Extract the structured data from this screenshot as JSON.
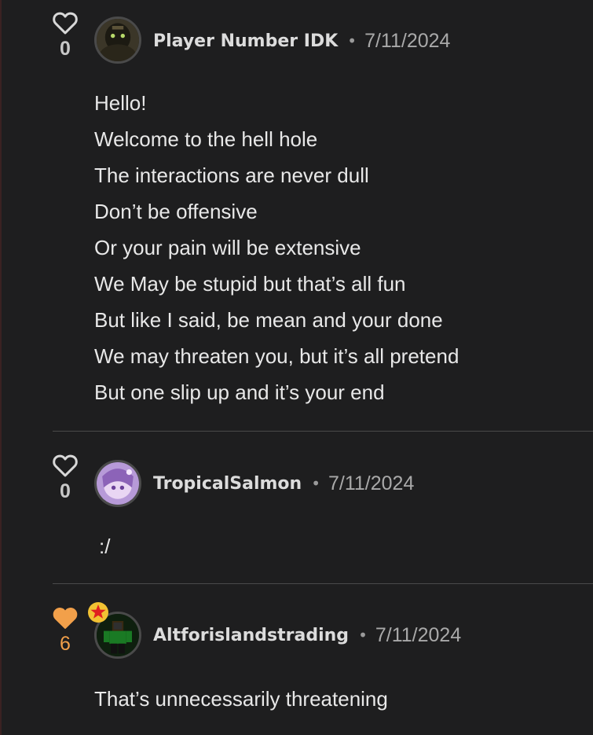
{
  "comments": [
    {
      "likes": "0",
      "liked": false,
      "username": "Player Number IDK",
      "separator": "•",
      "date": "7/11/2024",
      "lines": [
        "Hello!",
        "Welcome to the hell hole",
        "The interactions are never dull",
        "Don’t be offensive",
        "Or your pain will be extensive",
        "We May be stupid but that’s all fun",
        "But like I said, be mean and your done",
        "We may threaten you, but it’s all pretend",
        "But one slip up and it’s your end"
      ]
    },
    {
      "likes": "0",
      "liked": false,
      "username": "TropicalSalmon",
      "separator": "•",
      "date": "7/11/2024",
      "lines": [
        ":/"
      ]
    },
    {
      "likes": "6",
      "liked": true,
      "username": "Altforislandstrading",
      "separator": "•",
      "date": "7/11/2024",
      "lines": [
        "That’s unnecessarily threatening"
      ]
    }
  ],
  "colors": {
    "background": "#1e1e1f",
    "liked_heart": "#f2a04a",
    "badge_star_fill": "#e02020",
    "badge_star_ring": "#f2c233"
  },
  "icons": {
    "heart_outline": "heart-outline-icon",
    "heart_filled": "heart-filled-icon",
    "badge": "star-badge-icon"
  }
}
